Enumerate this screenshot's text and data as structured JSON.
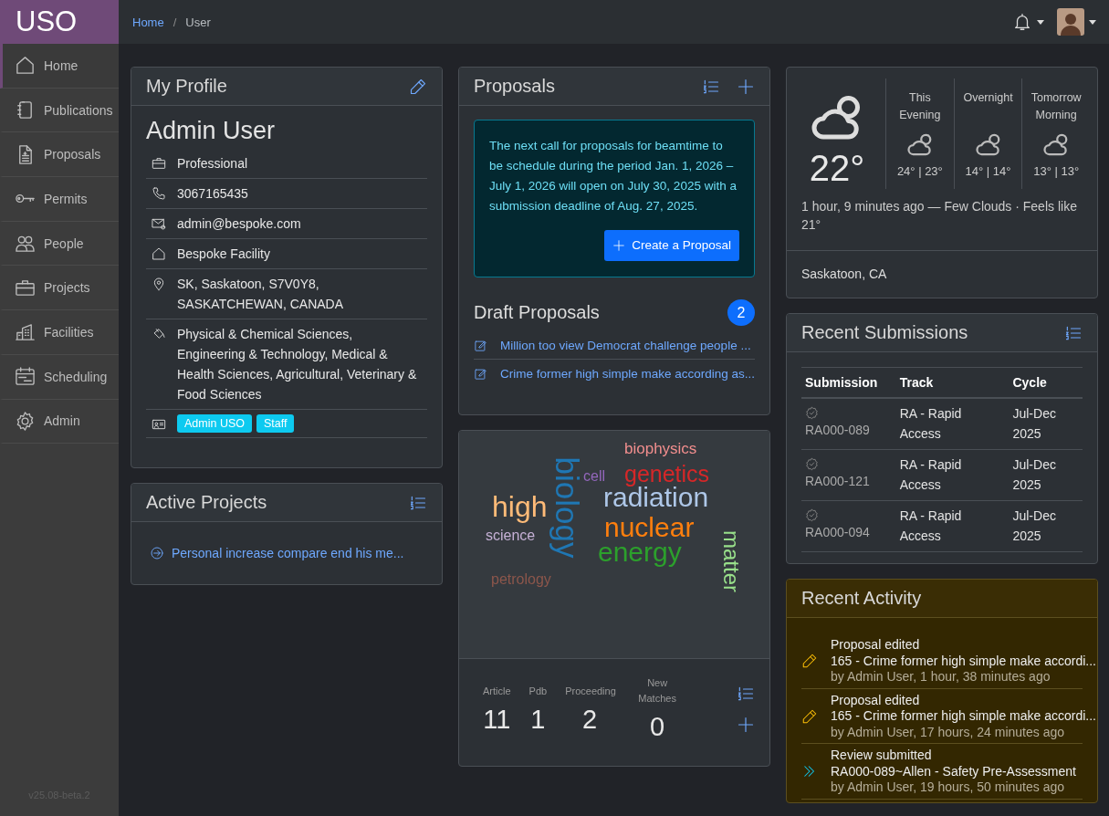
{
  "brand": {
    "logo": "USO"
  },
  "sidebar": {
    "items": [
      {
        "label": "Home",
        "selected": true
      },
      {
        "label": "Publications",
        "selected": false
      },
      {
        "label": "Proposals",
        "selected": false
      },
      {
        "label": "Permits",
        "selected": false
      },
      {
        "label": "People",
        "selected": false
      },
      {
        "label": "Projects",
        "selected": false
      },
      {
        "label": "Facilities",
        "selected": false
      },
      {
        "label": "Scheduling",
        "selected": false
      },
      {
        "label": "Admin",
        "selected": false
      }
    ],
    "version": "v25.08-beta.2"
  },
  "breadcrumb": [
    {
      "label": "Home",
      "kind": "link"
    },
    {
      "label": "/",
      "kind": "separator"
    },
    {
      "label": "User",
      "kind": "current"
    }
  ],
  "profile": {
    "title": "My Profile",
    "name": "Admin User",
    "rows": [
      "Professional",
      "3067165435",
      "admin@bespoke.com",
      "Bespoke Facility",
      "SK, Saskatoon, S7V0Y8, SASKATCHEWAN, CANADA",
      "Physical & Chemical Sciences, Engineering & Technology, Medical & Health Sciences, Agricultural, Veterinary & Food Sciences"
    ],
    "roles": [
      "Admin USO",
      "Staff"
    ]
  },
  "active_projects": {
    "title": "Active Projects",
    "items": [
      "Personal increase compare end his me..."
    ]
  },
  "proposals": {
    "title": "Proposals",
    "notice": "The next call for proposals for beamtime to be schedule during the period Jan. 1, 2026 – July 1, 2026 will open on July 30, 2025 with a submission deadline of Aug. 27, 2025.",
    "create_button": "Create a Proposal",
    "drafts_title": "Draft Proposals",
    "drafts_count": "2",
    "drafts": [
      "Million too view Democrat challenge people ...",
      "Crime former high simple make according as..."
    ]
  },
  "publications": {
    "words": [
      {
        "text": "biophysics",
        "color": "#f28e8e",
        "kind": "horizontal"
      },
      {
        "text": "genetics",
        "color": "#d62728",
        "kind": "horizontal"
      },
      {
        "text": "cell",
        "color": "#9467bd",
        "kind": "horizontal"
      },
      {
        "text": "biology",
        "color": "#1f77b4",
        "kind": "vertical"
      },
      {
        "text": "high",
        "color": "#ffbb78",
        "kind": "horizontal"
      },
      {
        "text": "radiation",
        "color": "#aec7e8",
        "kind": "horizontal"
      },
      {
        "text": "science",
        "color": "#c5b0d5",
        "kind": "horizontal"
      },
      {
        "text": "nuclear",
        "color": "#ff7f0e",
        "kind": "horizontal"
      },
      {
        "text": "energy",
        "color": "#2ca02c",
        "kind": "horizontal"
      },
      {
        "text": "matter",
        "color": "#98df8a",
        "kind": "vertical"
      },
      {
        "text": "petrology",
        "color": "#8c564b",
        "kind": "horizontal"
      }
    ],
    "counts": [
      {
        "label": "Article",
        "value": "11"
      },
      {
        "label": "Pdb",
        "value": "1"
      },
      {
        "label": "Proceeding",
        "value": "2"
      },
      {
        "label": "New Matches",
        "value": "0"
      }
    ]
  },
  "weather": {
    "temperature": "22°",
    "forecast": [
      {
        "label": "This Evening",
        "temps": "24° | 23°"
      },
      {
        "label": "Overnight",
        "temps": "14° | 14°"
      },
      {
        "label": "Tomorrow Morning",
        "temps": "13° | 13°"
      }
    ],
    "summary": "1 hour, 9 minutes ago — Few Clouds · Feels like 21°",
    "location": "Saskatoon, CA"
  },
  "recent_submissions": {
    "title": "Recent Submissions",
    "columns": [
      "Submission",
      "Track",
      "Cycle"
    ],
    "rows": [
      {
        "submission": "RA000-089",
        "track": "RA - Rapid Access",
        "cycle": "Jul-Dec 2025"
      },
      {
        "submission": "RA000-121",
        "track": "RA - Rapid Access",
        "cycle": "Jul-Dec 2025"
      },
      {
        "submission": "RA000-094",
        "track": "RA - Rapid Access",
        "cycle": "Jul-Dec 2025"
      }
    ]
  },
  "recent_activity": {
    "title": "Recent Activity",
    "items": [
      {
        "kind": "edited",
        "title": "Proposal edited",
        "detail": "165 - Crime former high simple make accordi...",
        "meta": "by Admin User, 1 hour, 38 minutes ago"
      },
      {
        "kind": "edited",
        "title": "Proposal edited",
        "detail": "165 - Crime former high simple make accordi...",
        "meta": "by Admin User, 17 hours, 24 minutes ago"
      },
      {
        "kind": "submitted",
        "title": "Review submitted",
        "detail": "RA000-089~Allen - Safety Pre-Assessment",
        "meta": "by Admin User, 19 hours, 50 minutes ago"
      }
    ]
  }
}
